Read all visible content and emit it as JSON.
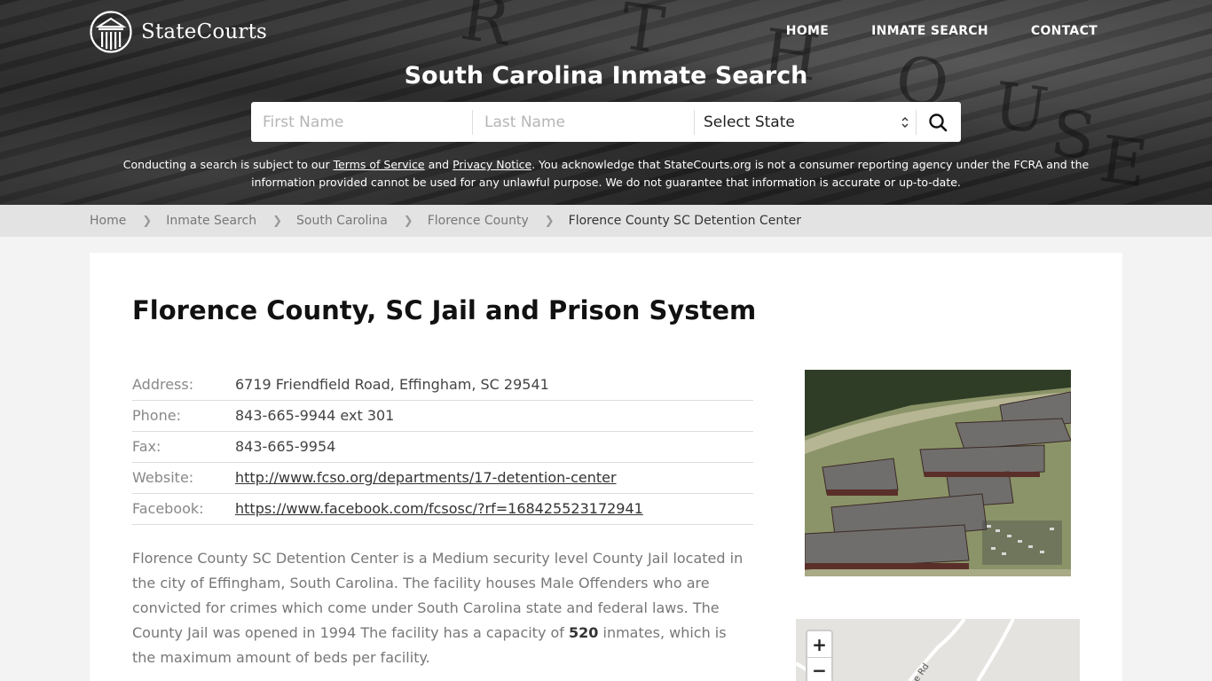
{
  "header": {
    "logo_text": "StateCourts",
    "nav": [
      {
        "label": "HOME"
      },
      {
        "label": "INMATE SEARCH"
      },
      {
        "label": "CONTACT"
      }
    ],
    "hero_title": "South Carolina Inmate Search",
    "search": {
      "first_name_placeholder": "First Name",
      "last_name_placeholder": "Last Name",
      "state_value": "Select State",
      "search_icon": "search-icon"
    },
    "disclaimer": {
      "pre": "Conducting a search is subject to our ",
      "terms_link": "Terms of Service",
      "mid": " and ",
      "privacy_link": "Privacy Notice",
      "post": ". You acknowledge that StateCourts.org is not a consumer reporting agency under the FCRA and the information provided cannot be used for any unlawful purpose. We do not guarantee that information is accurate or up-to-date."
    }
  },
  "breadcrumb": [
    {
      "label": "Home"
    },
    {
      "label": "Inmate Search"
    },
    {
      "label": "South Carolina"
    },
    {
      "label": "Florence County"
    },
    {
      "label": "Florence County SC Detention Center"
    }
  ],
  "main": {
    "title": "Florence County, SC Jail and Prison System",
    "info": [
      {
        "label": "Address:",
        "value": "6719 Friendfield Road, Effingham, SC 29541"
      },
      {
        "label": "Phone:",
        "value": "843-665-9944 ext 301"
      },
      {
        "label": "Fax:",
        "value": "843-665-9954"
      },
      {
        "label": "Website:",
        "value": "http://www.fcso.org/departments/17-detention-center"
      },
      {
        "label": "Facebook:",
        "value": "https://www.facebook.com/fcsosc/?rf=168425523172941"
      }
    ],
    "description": {
      "part1": "Florence County SC Detention Center is a Medium security level County Jail located in the city of Effingham, South Carolina. The facility houses Male Offenders who are convicted for crimes which come under South Carolina state and federal laws. The County Jail was opened in 1994 The facility has a capacity of ",
      "capacity": "520",
      "part2": " inmates, which is the maximum amount of beds per facility."
    },
    "map": {
      "zoom_in": "+",
      "zoom_out": "−",
      "road_label": "e Rd"
    }
  }
}
